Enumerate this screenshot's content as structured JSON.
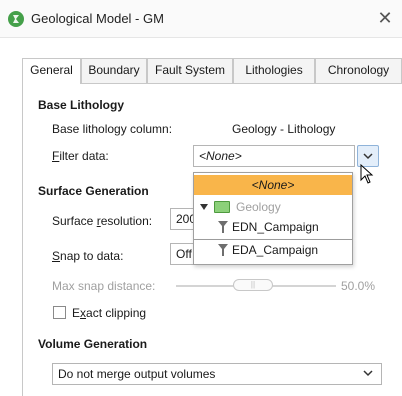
{
  "window": {
    "title": "Geological Model - GM",
    "close_glyph": "✕"
  },
  "tabs": [
    "General",
    "Boundary",
    "Fault System",
    "Lithologies",
    "Chronology"
  ],
  "base_lithology": {
    "heading": "Base Lithology",
    "column_label": "Base lithology column:",
    "column_value": "Geology - Lithology",
    "filter_label": "Filter data:",
    "filter_value": "<None>"
  },
  "dropdown": {
    "items": [
      {
        "label": "<None>",
        "selected": true
      },
      {
        "label": "Geology",
        "type": "folder"
      },
      {
        "label": "EDN_Campaign",
        "type": "filter"
      },
      {
        "label": "EDA_Campaign",
        "type": "filter"
      }
    ]
  },
  "surface_generation": {
    "heading": "Surface Generation",
    "resolution_label": "Surface resolution:",
    "resolution_value": "200",
    "snap_label": "Snap to data:",
    "snap_value": "Off",
    "max_snap_label": "Max snap distance:",
    "max_snap_value": "50.0%",
    "max_snap_fraction": 0.5,
    "exact_clipping_label": "Exact clipping",
    "exact_clipping_checked": false
  },
  "volume_generation": {
    "heading": "Volume Generation",
    "mode_value": "Do not merge output volumes"
  },
  "colors": {
    "accent": "#f9b54a",
    "folder": "#8cd07a",
    "app_icon": "#45a04a"
  }
}
